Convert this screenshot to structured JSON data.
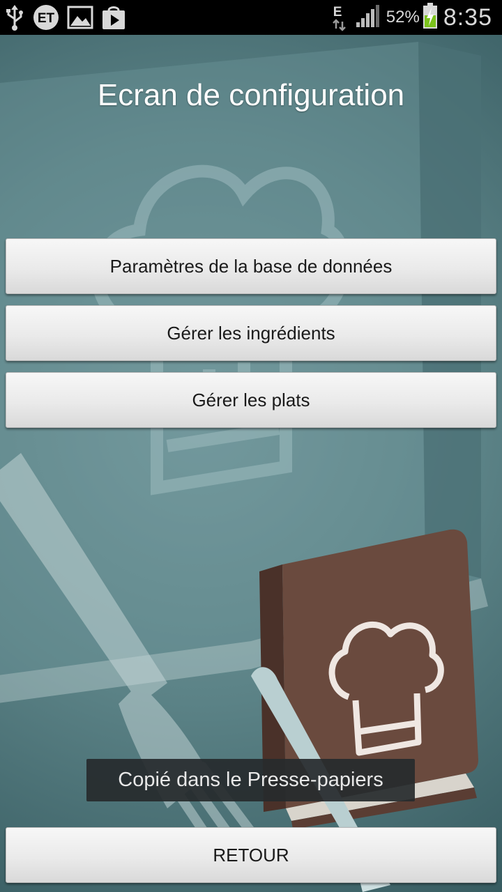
{
  "status_bar": {
    "left_icons": [
      "usb-icon",
      "et-icon",
      "image-icon",
      "play-store-icon"
    ],
    "network_type": "E",
    "battery_percent": "52%",
    "time": "8:35"
  },
  "screen": {
    "title": "Ecran de configuration"
  },
  "buttons": {
    "database_settings": "Paramètres de la base de données",
    "manage_ingredients": "Gérer les ingrédients",
    "manage_dishes": "Gérer les plats",
    "back": "RETOUR"
  },
  "toast": {
    "message": "Copié dans le Presse-papiers"
  },
  "colors": {
    "background_teal": "#5b8286",
    "book_brown": "#6a4a3e",
    "button_face": "#ececec"
  }
}
